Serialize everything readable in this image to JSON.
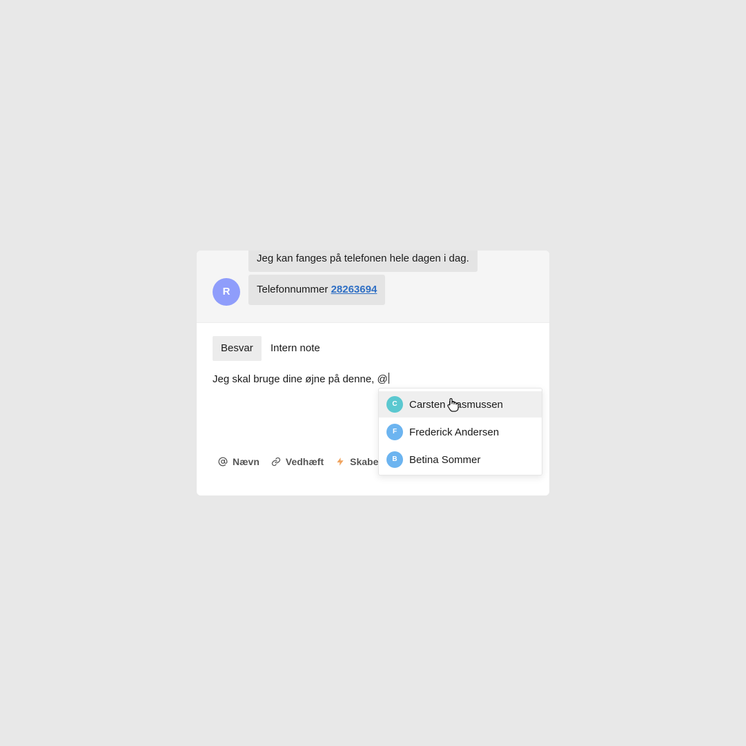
{
  "thread": {
    "message_1": "Jeg kan fanges på telefonen hele dagen i dag.",
    "message_2_prefix": "Telefonnummer",
    "phone_number": "28263694",
    "sender_initial": "R"
  },
  "composer": {
    "tabs": [
      {
        "label": "Besvar",
        "active": true
      },
      {
        "label": "Intern note",
        "active": false
      }
    ],
    "text": "Jeg skal bruge dine øjne på denne, @"
  },
  "toolbar": {
    "mention_label": "Nævn",
    "attach_label": "Vedhæft",
    "templates_label": "Skabe"
  },
  "mention_dropdown": {
    "options": [
      {
        "initial": "C",
        "name": "Carsten Rasmussen",
        "color": "#5bc8d0",
        "highlighted": true
      },
      {
        "initial": "F",
        "name": "Frederick Andersen",
        "color": "#6cb4f0",
        "highlighted": false
      },
      {
        "initial": "B",
        "name": "Betina Sommer",
        "color": "#6cb4f0",
        "highlighted": false
      }
    ]
  },
  "colors": {
    "avatar_r": "#8f9dfb",
    "link": "#2f6fc4",
    "lightning": "#f0a35e"
  }
}
